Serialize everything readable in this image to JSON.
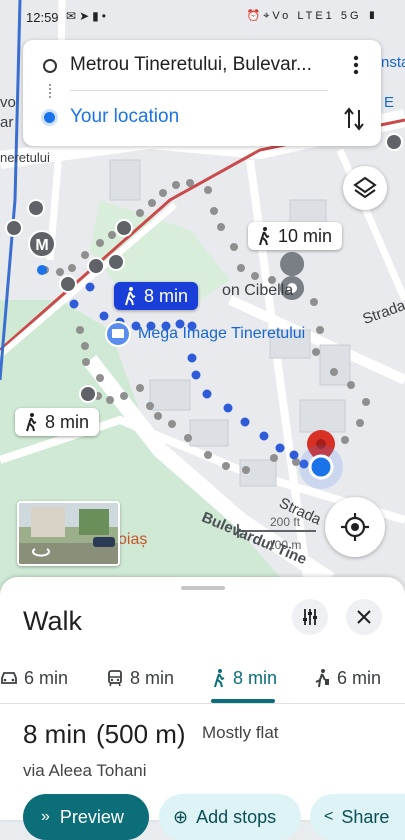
{
  "status_bar": {
    "time": "12:59",
    "left_icons": [
      "notification-icon",
      "telegram-icon",
      "bag-icon",
      "dot-icon"
    ],
    "network": "5G",
    "carrier": "Vo LTE1"
  },
  "directions": {
    "origin": "Metrou Tineretului, Bulevar...",
    "destination": "Your location"
  },
  "map": {
    "route_chips": [
      {
        "label": "10 min",
        "selected": false
      },
      {
        "label": "8 min",
        "selected": true
      },
      {
        "label": "8 min",
        "selected": false
      }
    ],
    "places": {
      "cibella": "on Cibella",
      "mega_image": "Mega Image Tineretului",
      "street_strada_right": "Strada",
      "street_strada_bottom": "Strada",
      "bulevardul": "Bulevardul Tine",
      "poias": "oiaș",
      "metro_letter": "M",
      "left_edge_1": "vo",
      "left_edge_2": "ar",
      "left_edge_3": "neretului",
      "right_edge_1": "nsta",
      "right_edge_2": "E"
    },
    "scale": {
      "feet": "200 ft",
      "meters": "100 m"
    },
    "accent_colors": {
      "route_blue": "#2f5bd8",
      "alt_route_gray": "#8f8f8f",
      "destination_red": "#d93025"
    }
  },
  "sheet": {
    "title": "Walk",
    "modes": [
      {
        "icon": "car-icon",
        "label": "6 min",
        "active": false
      },
      {
        "icon": "transit-icon",
        "label": "8 min",
        "active": false
      },
      {
        "icon": "walk-icon",
        "label": "8 min",
        "active": true
      },
      {
        "icon": "ride-icon",
        "label": "6 min",
        "active": false
      }
    ],
    "route": {
      "time": "8 min",
      "distance": "(500 m)",
      "note": "Mostly flat",
      "via": "via Aleea Tohani"
    },
    "buttons": {
      "preview": "Preview",
      "add_stops": "Add stops",
      "share": "Share"
    }
  }
}
